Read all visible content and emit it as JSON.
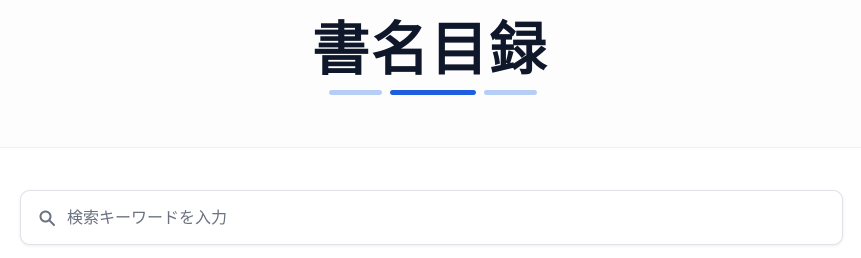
{
  "header": {
    "title": "書名目録"
  },
  "search": {
    "placeholder": "検索キーワードを入力",
    "value": "",
    "icon": "search-icon"
  },
  "colors": {
    "title": "#0f172a",
    "accent": "#1d5fe0",
    "accent_light": "#b6cdf5",
    "placeholder": "#6b7280"
  }
}
